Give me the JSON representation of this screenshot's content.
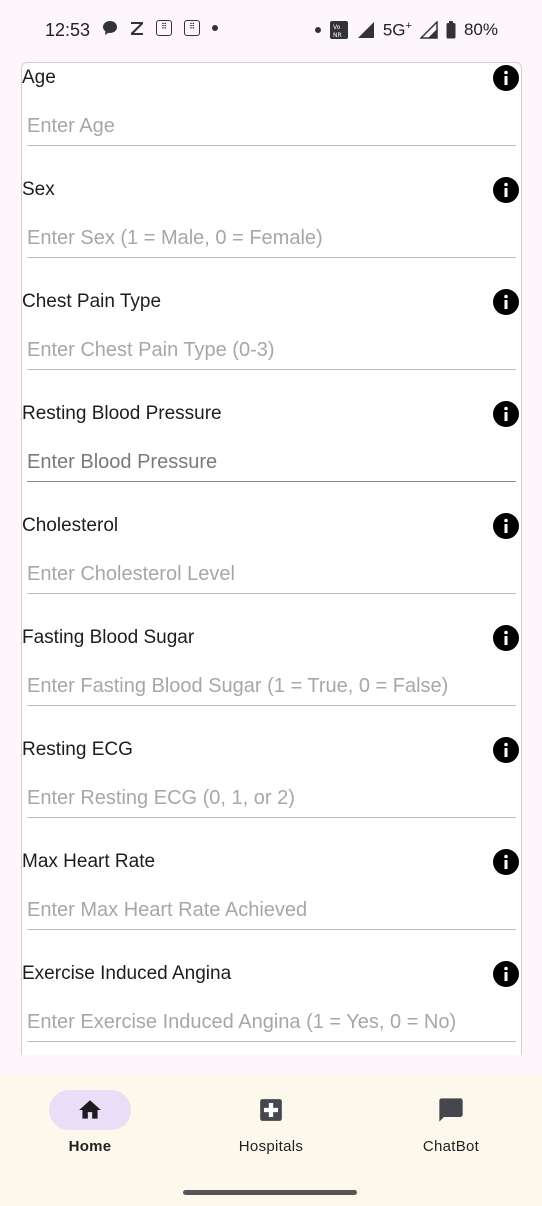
{
  "status_bar": {
    "time": "12:53",
    "network": "5G",
    "battery": "80%"
  },
  "form": {
    "fields": [
      {
        "label": "Age",
        "placeholder": "Enter Age"
      },
      {
        "label": "Sex",
        "placeholder": "Enter Sex (1 = Male, 0 = Female)"
      },
      {
        "label": "Chest Pain Type",
        "placeholder": "Enter Chest Pain Type (0-3)"
      },
      {
        "label": "Resting Blood Pressure",
        "placeholder": "Enter Blood Pressure"
      },
      {
        "label": "Cholesterol",
        "placeholder": "Enter Cholesterol Level"
      },
      {
        "label": "Fasting Blood Sugar",
        "placeholder": "Enter Fasting Blood Sugar (1 = True, 0 = False)"
      },
      {
        "label": "Resting ECG",
        "placeholder": "Enter Resting ECG (0, 1, or 2)"
      },
      {
        "label": "Max Heart Rate",
        "placeholder": "Enter Max Heart Rate Achieved"
      },
      {
        "label": "Exercise Induced Angina",
        "placeholder": "Enter Exercise Induced Angina (1 = Yes, 0 = No)"
      }
    ]
  },
  "bottom_nav": {
    "items": [
      {
        "label": "Home",
        "icon": "home-icon",
        "active": true
      },
      {
        "label": "Hospitals",
        "icon": "medical-cross-icon",
        "active": false
      },
      {
        "label": "ChatBot",
        "icon": "chat-icon",
        "active": false
      }
    ]
  },
  "colors": {
    "active_pill": "#e8def8",
    "nav_background": "#fcf8ec",
    "page_background": "#fdf7fd"
  }
}
